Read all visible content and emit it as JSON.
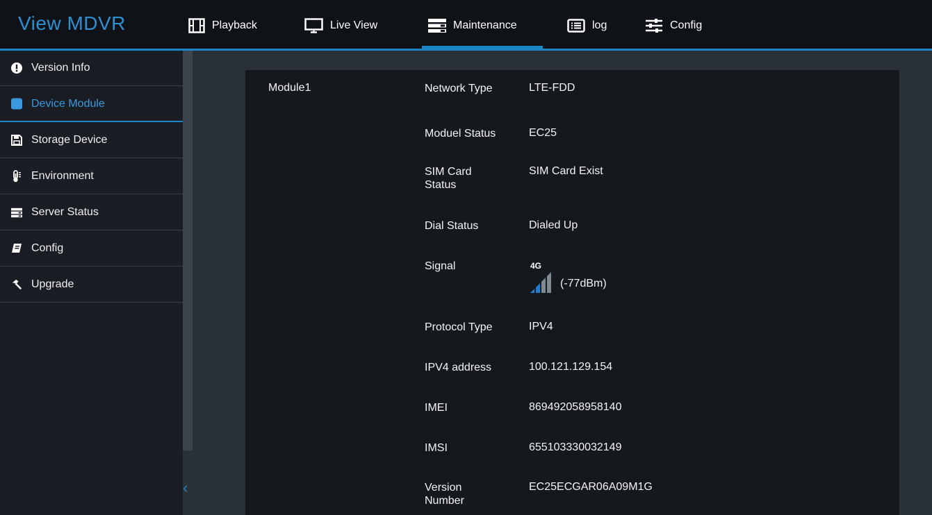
{
  "app_title": "View MDVR",
  "nav": [
    {
      "label": "Playback",
      "icon": "film-icon"
    },
    {
      "label": "Live View",
      "icon": "monitor-icon"
    },
    {
      "label": "Maintenance",
      "icon": "server-icon",
      "active": true
    },
    {
      "label": "log",
      "icon": "list-icon"
    },
    {
      "label": "Config",
      "icon": "sliders-icon"
    }
  ],
  "sidebar": {
    "items": [
      {
        "label": "Version Info",
        "icon": "info-icon"
      },
      {
        "label": "Device Module",
        "icon": "module-icon",
        "active": true
      },
      {
        "label": "Storage Device",
        "icon": "floppy-icon"
      },
      {
        "label": "Environment",
        "icon": "thermometer-icon"
      },
      {
        "label": "Server Status",
        "icon": "server-icon"
      },
      {
        "label": "Config",
        "icon": "book-icon"
      },
      {
        "label": "Upgrade",
        "icon": "hammer-icon"
      }
    ]
  },
  "module": {
    "title": "Module1",
    "rows": [
      {
        "label": "Network Type",
        "value": "LTE-FDD"
      },
      {
        "label": "Moduel Status",
        "value": "EC25"
      },
      {
        "label": "SIM Card Status",
        "value": "SIM Card Exist"
      },
      {
        "label": "Dial Status",
        "value": "Dialed Up"
      },
      {
        "label": "Signal",
        "value": "(-77dBm)",
        "network": "4G",
        "bars_filled": 2,
        "bars_total": 4
      },
      {
        "label": "Protocol Type",
        "value": "IPV4"
      },
      {
        "label": "IPV4 address",
        "value": "100.121.129.154"
      },
      {
        "label": "IMEI",
        "value": "869492058958140"
      },
      {
        "label": "IMSI",
        "value": "655103330032149"
      },
      {
        "label": "Version Number",
        "value": "EC25ECGAR06A09M1G"
      }
    ]
  },
  "colors": {
    "accent": "#1b86c4",
    "background": "#2a3038",
    "panel": "#15191e",
    "topbar": "#0f1318"
  }
}
